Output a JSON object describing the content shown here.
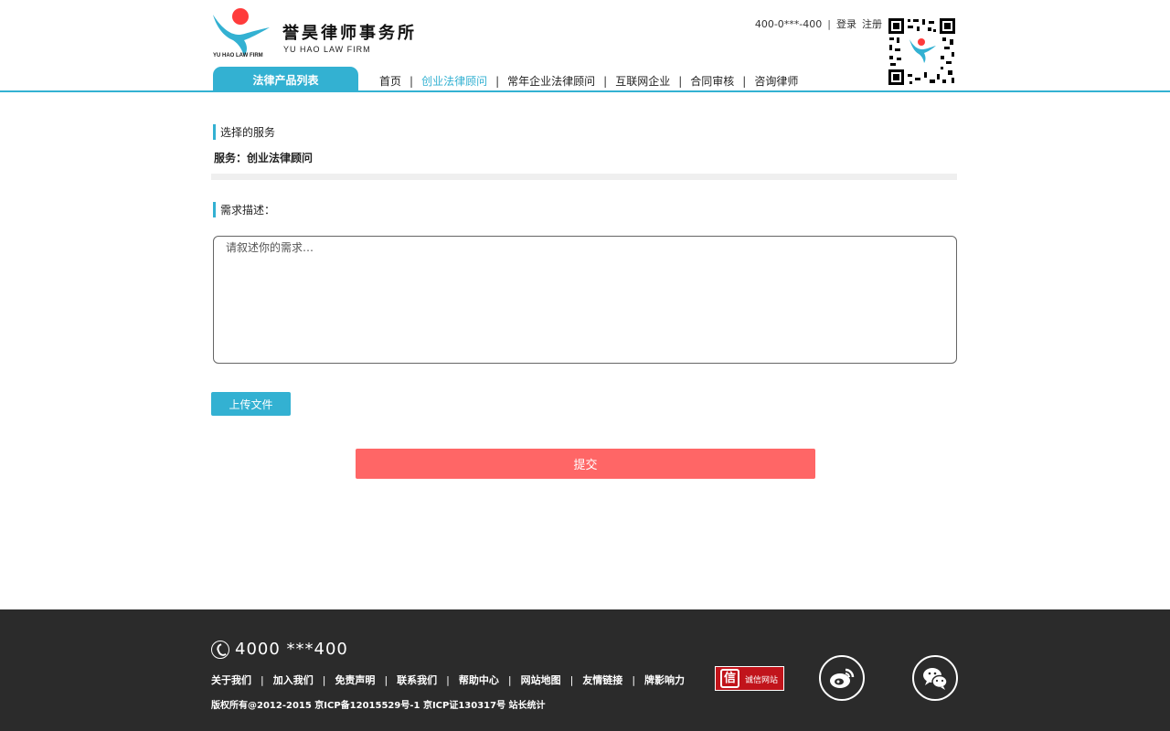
{
  "header": {
    "logo_text": "YU HAO LAW FIRM",
    "firm_name": "誉昊律师事务所",
    "firm_name_en": "YU HAO LAW FIRM",
    "top_links": {
      "phone": "400-0***-400",
      "separator": "|",
      "login": "登录",
      "register": "注册"
    },
    "products_tab": "法律产品列表",
    "nav": [
      {
        "label": "首页",
        "active": false
      },
      {
        "label": "创业法律顾问",
        "active": true
      },
      {
        "label": "常年企业法律顾问",
        "active": false
      },
      {
        "label": "互联网企业",
        "active": false
      },
      {
        "label": "合同审核",
        "active": false
      },
      {
        "label": "咨询律师",
        "active": false
      }
    ],
    "nav_separator": "|",
    "accent_color": "#33b1d2"
  },
  "main": {
    "selected_service_heading": "选择的服务",
    "service_line": "服务：创业法律顾问",
    "requirement_heading": "需求描述：",
    "requirement_placeholder": "请叙述你的需求…",
    "requirement_value": "",
    "upload_label": "上传文件",
    "submit_label": "提交",
    "submit_color": "#ff6666"
  },
  "footer": {
    "phone": "4000 ***400",
    "links": [
      "关于我们",
      "加入我们",
      "免责声明",
      "联系我们",
      "帮助中心",
      "网站地图",
      "友情链接",
      "牌影响力"
    ],
    "link_separator": "|",
    "copyright": "版权所有@2012-2015 京ICP备12015529号-1 京ICP证130317号 站长统计",
    "trust_badge": {
      "seal": "信",
      "text": "诚信网站"
    },
    "social_icons": [
      "weibo-icon",
      "wechat-icon"
    ],
    "background_color": "#2b2b2b"
  }
}
